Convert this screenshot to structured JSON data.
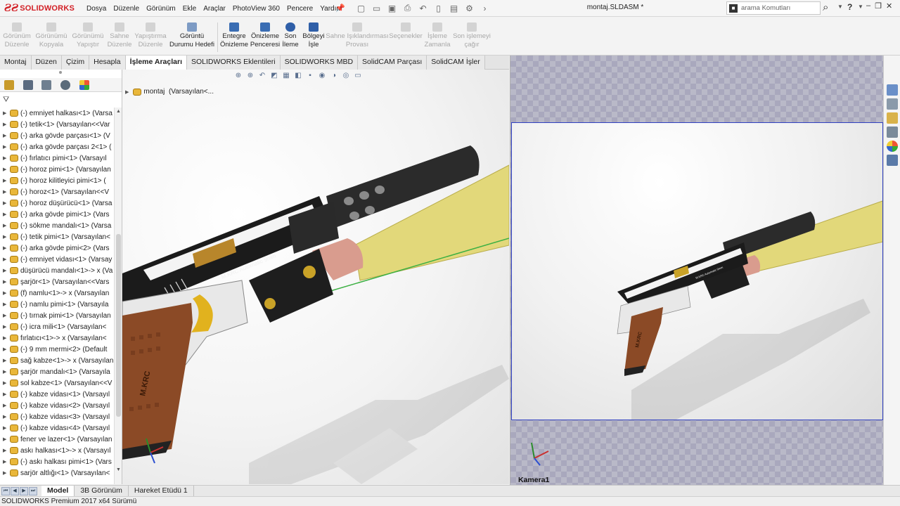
{
  "app": {
    "logo_text": "SOLIDWORKS",
    "document_title": "montaj.SLDASM *"
  },
  "menu": [
    "Dosya",
    "Düzenle",
    "Görünüm",
    "Ekle",
    "Araçlar",
    "PhotoView 360",
    "Pencere",
    "Yardım"
  ],
  "search": {
    "placeholder": "arama Komutları"
  },
  "help_label": "?",
  "commands": [
    {
      "label_1": "Görünüm",
      "label_2": "Düzenle",
      "enabled": false
    },
    {
      "label_1": "Görünümü",
      "label_2": "Kopyala",
      "enabled": false
    },
    {
      "label_1": "Görünümü",
      "label_2": "Yapıştır",
      "enabled": false
    },
    {
      "label_1": "Sahne",
      "label_2": "Düzenle",
      "enabled": false
    },
    {
      "label_1": "Yapıştırma",
      "label_2": "Düzenle",
      "enabled": false
    },
    {
      "label_1": "Görüntü",
      "label_2": "Durumu Hedefi",
      "enabled": true
    },
    {
      "label_1": "Entegre",
      "label_2": "Önizleme",
      "enabled": true
    },
    {
      "label_1": "Önizleme",
      "label_2": "Penceresi",
      "enabled": true
    },
    {
      "label_1": "Son",
      "label_2": "İleme",
      "enabled": true
    },
    {
      "label_1": "Bölgeyi",
      "label_2": "İşle",
      "enabled": true
    },
    {
      "label_1": "Sahne Işıklandırması",
      "label_2": "Provası",
      "enabled": false
    },
    {
      "label_1": "Seçenekler",
      "label_2": "",
      "enabled": false
    },
    {
      "label_1": "İşleme",
      "label_2": "Zamanla",
      "enabled": false
    },
    {
      "label_1": "Son işlemeyi",
      "label_2": "çağır",
      "enabled": false
    }
  ],
  "tabs": [
    "Montaj",
    "Düzen",
    "Çizim",
    "Hesapla",
    "İşleme Araçları",
    "SOLIDWORKS Eklentileri",
    "SOLIDWORKS MBD",
    "SolidCAM Parçası",
    "SolidCAM İşler"
  ],
  "active_tab": "İşleme Araçları",
  "tree": [
    "(-) emniyet halkası<1> (Varsa",
    "(-) tetik<1> (Varsayılan<<Var",
    "(-) arka gövde parçası<1> (V",
    "(-) arka gövde parçası 2<1> (",
    "(-) fırlatıcı pimi<1> (Varsayıl",
    "(-) horoz pimi<1> (Varsayılan",
    "(-) horoz kilitleyici pimi<1> (",
    "(-) horoz<1> (Varsayılan<<V",
    "(-) horoz düşürücü<1> (Varsa",
    "(-) arka gövde pimi<1> (Vars",
    "(-) sökme mandalı<1> (Varsa",
    "(-) tetik pimi<1> (Varsayılan<",
    "(-) arka gövde pimi<2> (Vars",
    "(-) emniyet vidası<1> (Varsay",
    "düşürücü mandalı<1>-> x (Va",
    "şarjör<1> (Varsayılan<<Vars",
    "(f) namlu<1>-> x (Varsayılan",
    "(-) namlu pimi<1> (Varsayıla",
    "(-) tırnak pimi<1> (Varsayılan",
    "(-) icra mili<1> (Varsayılan<",
    "fırlatıcı<1>-> x (Varsayılan<",
    "(-) 9 mm mermi<2> (Default",
    "sağ kabze<1>-> x (Varsayılan",
    "şarjör mandalı<1> (Varsayıla",
    "sol kabze<1> (Varsayılan<<V",
    "(-) kabze vidası<1> (Varsayıl",
    "(-) kabze vidası<2> (Varsayıl",
    "(-) kabze vidası<3> (Varsayıl",
    "(-) kabze vidası<4> (Varsayıl",
    "fener ve lazer<1> (Varsayılan",
    "askı halkası<1>-> x (Varsayıl",
    "(-) askı halkası pimi<1> (Vars",
    "sarjör altlığı<1> (Varsayılan<"
  ],
  "viewport": {
    "tree_root_label": "montaj",
    "tree_root_config": "(Varsayılan<...",
    "engraving": "M.KRC Automatic 9mm",
    "grip_text": "M.KRC"
  },
  "render": {
    "camera_label": "Kamera1",
    "engraving_small": "M.KRC Automatic 9mm",
    "grip_text_small": "M.KRC"
  },
  "bottom_tabs": [
    "Model",
    "3B Görünüm",
    "Hareket Etüdü 1"
  ],
  "active_bottom_tab": "Model",
  "status_text": "SOLIDWORKS Premium 2017 x64 Sürümü",
  "colors": {
    "brand": "#d21e24",
    "grip_wood": "#8b4a26",
    "laser_beam": "#e2d87a",
    "render_border": "#3040c0"
  }
}
